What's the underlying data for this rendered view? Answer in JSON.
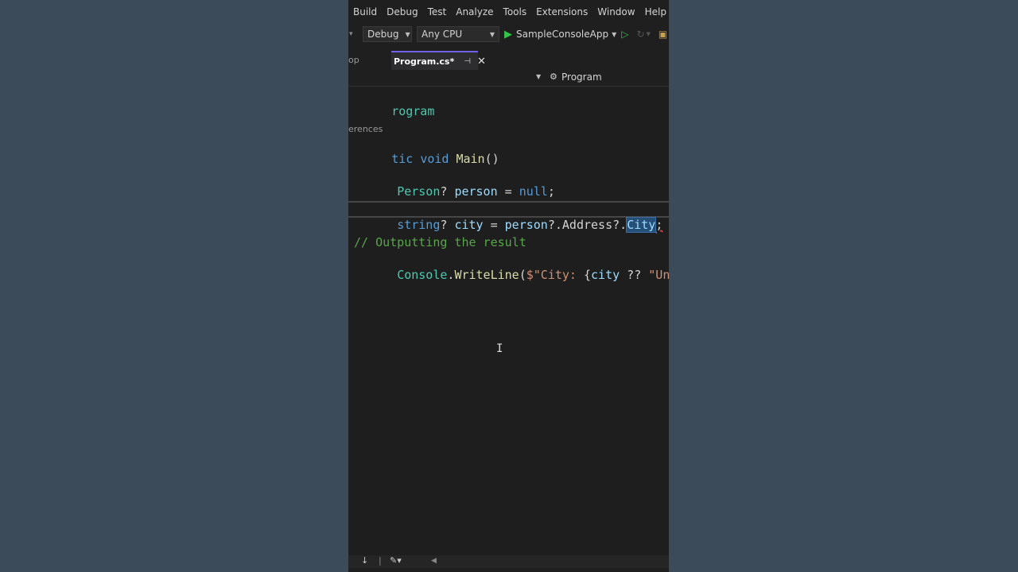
{
  "menu": {
    "items": [
      "Build",
      "Debug",
      "Test",
      "Analyze",
      "Tools",
      "Extensions",
      "Window",
      "Help"
    ]
  },
  "toolbar": {
    "configuration": "Debug",
    "platform": "Any CPU",
    "run_target": "SampleConsoleApp"
  },
  "tabs": {
    "previous_fragment": "op",
    "active_label": "Program.cs*"
  },
  "navbar": {
    "class_name": "Program"
  },
  "editor": {
    "line1": "rogram",
    "codelens": "erences",
    "line3_tic": "tic ",
    "line3_void": "void ",
    "line3_main": "Main",
    "line3_paren": "()",
    "line4_type": "Person",
    "line4_rest": "? ",
    "line4_var": "person",
    "line4_eq": " = ",
    "line4_null": "null",
    "line4_semi": ";",
    "line5_type": "string",
    "line5_q": "? ",
    "line5_var": "city",
    "line5_eq": " = ",
    "line5_person": "person",
    "line5_dot1": "?.",
    "line5_address": "Address",
    "line5_dot2": "?.",
    "line5_city": "City",
    "line5_semi": ";",
    "comment": "// Outputting the result",
    "line7_console": "Console",
    "line7_dot": ".",
    "line7_write": "WriteLine",
    "line7_open": "(",
    "line7_str1": "$\"City: ",
    "line7_brace": "{",
    "line7_city": "city",
    "line7_op": " ?? ",
    "line7_str2": "\"Unknown"
  }
}
